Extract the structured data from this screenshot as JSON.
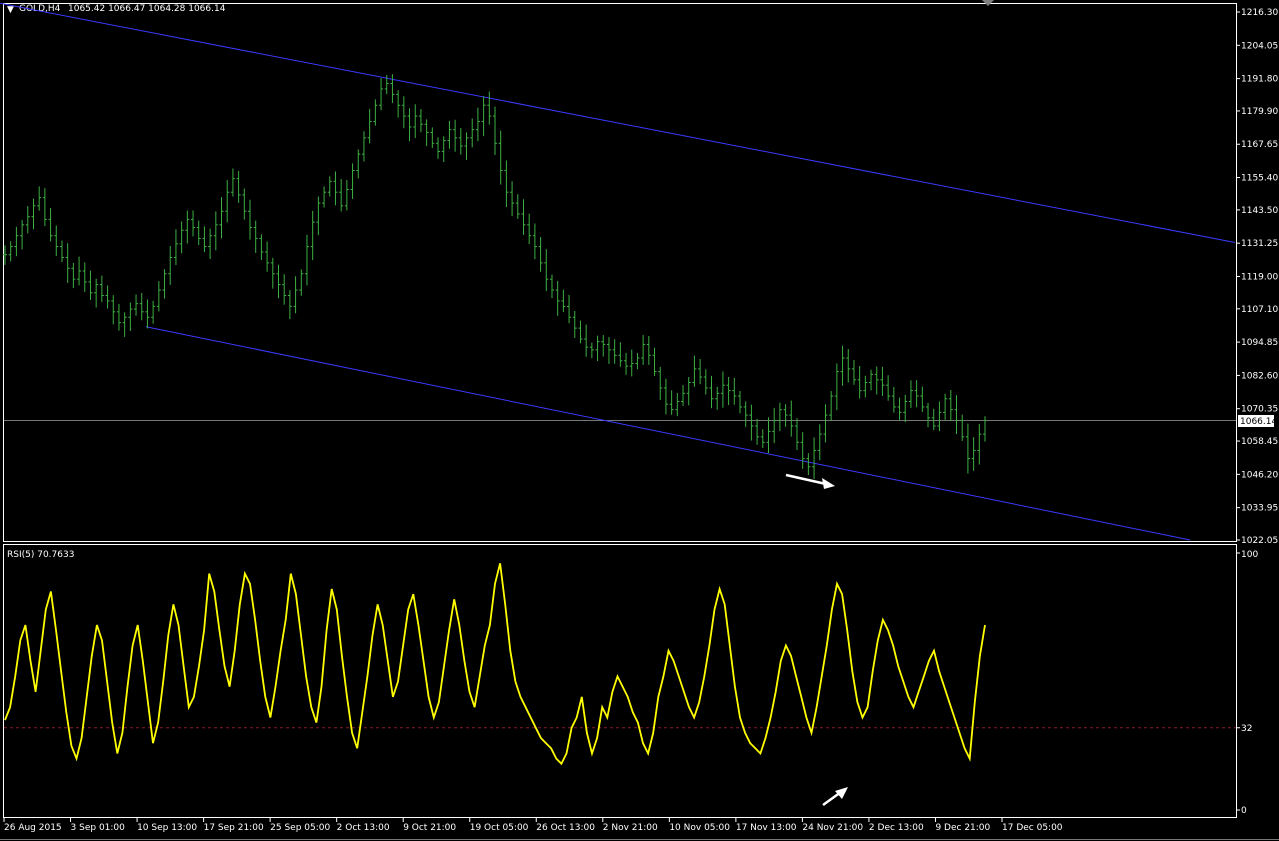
{
  "header": {
    "symbol": "GOLD,H4",
    "ohlc": "1065.42 1066.47 1064.28 1066.14",
    "rsi_label": "RSI(5) 70.7633"
  },
  "colors": {
    "background": "#000000",
    "candles": "#3cb043",
    "channel": "#3a3aff",
    "rsi_line": "#ffff00",
    "rsi_level": "#8b1a2a",
    "grid": "#ffffff",
    "arrow": "#ffffff"
  },
  "chart_data": [
    {
      "type": "bar",
      "name": "price",
      "symbol": "GOLD",
      "timeframe": "H4",
      "ylim": [
        1022.05,
        1216.3
      ],
      "y_ticks": [
        "1216.30",
        "1204.05",
        "1191.80",
        "1179.90",
        "1167.65",
        "1155.40",
        "1143.50",
        "1131.25",
        "1119.00",
        "1107.10",
        "1094.85",
        "1082.60",
        "1070.35",
        "1058.45",
        "1046.20",
        "1033.95",
        "1022.05"
      ],
      "current_price": "1066.14",
      "x_ticks": [
        "26 Aug 2015",
        "3 Sep 01:00",
        "10 Sep 13:00",
        "17 Sep 21:00",
        "25 Sep 05:00",
        "2 Oct 13:00",
        "9 Oct 21:00",
        "19 Oct 05:00",
        "26 Oct 13:00",
        "2 Nov 21:00",
        "10 Nov 05:00",
        "17 Nov 13:00",
        "24 Nov 21:00",
        "2 Dec 13:00",
        "9 Dec 21:00",
        "17 Dec 05:00"
      ],
      "closes": [
        1127,
        1130,
        1134,
        1138,
        1141,
        1145,
        1148,
        1140,
        1134,
        1130,
        1126,
        1122,
        1118,
        1121,
        1117,
        1113,
        1116,
        1112,
        1110,
        1106,
        1102,
        1104,
        1107,
        1109,
        1106,
        1104,
        1108,
        1114,
        1120,
        1126,
        1131,
        1136,
        1140,
        1137,
        1133,
        1130,
        1134,
        1138,
        1143,
        1150,
        1155,
        1149,
        1143,
        1137,
        1133,
        1128,
        1124,
        1120,
        1116,
        1112,
        1108,
        1114,
        1120,
        1130,
        1139,
        1146,
        1150,
        1154,
        1150,
        1145,
        1151,
        1158,
        1164,
        1170,
        1176,
        1182,
        1188,
        1190,
        1186,
        1182,
        1178,
        1174,
        1178,
        1175,
        1172,
        1168,
        1165,
        1169,
        1173,
        1170,
        1167,
        1170,
        1173,
        1176,
        1182,
        1178,
        1168,
        1158,
        1150,
        1146,
        1142,
        1138,
        1134,
        1130,
        1124,
        1118,
        1114,
        1110,
        1108,
        1104,
        1100,
        1096,
        1093,
        1092,
        1095,
        1094,
        1092,
        1090,
        1088,
        1086,
        1087,
        1089,
        1094,
        1090,
        1084,
        1078,
        1072,
        1070,
        1073,
        1076,
        1080,
        1085,
        1082,
        1078,
        1074,
        1076,
        1079,
        1077,
        1075,
        1071,
        1068,
        1064,
        1060,
        1058,
        1062,
        1066,
        1070,
        1068,
        1064,
        1058,
        1052,
        1049,
        1055,
        1061,
        1068,
        1075,
        1084,
        1089,
        1085,
        1081,
        1077,
        1080,
        1083,
        1081,
        1079,
        1075,
        1071,
        1069,
        1073,
        1077,
        1075,
        1071,
        1067,
        1064,
        1069,
        1074,
        1070,
        1066,
        1060,
        1052,
        1055,
        1061,
        1066
      ],
      "channel_upper": [
        [
          0,
          1219.5
        ],
        [
          1235,
          1131.5
        ]
      ],
      "channel_lower": [
        [
          146,
          1100.5
        ],
        [
          1190,
          1022.05
        ]
      ],
      "annotations": [
        "arrow-down-right near lower channel",
        "arrow-up-right near RSI low"
      ]
    },
    {
      "type": "line",
      "name": "RSI",
      "title": "RSI(5) 70.7633",
      "ylim": [
        0,
        100
      ],
      "y_ticks": [
        "100",
        "32",
        "0"
      ],
      "level": 32,
      "values": [
        35,
        40,
        52,
        66,
        72,
        58,
        46,
        62,
        78,
        85,
        70,
        54,
        38,
        25,
        20,
        28,
        44,
        60,
        72,
        66,
        50,
        34,
        22,
        30,
        48,
        64,
        72,
        58,
        42,
        26,
        34,
        50,
        68,
        80,
        72,
        56,
        40,
        44,
        56,
        70,
        92,
        85,
        70,
        56,
        48,
        62,
        80,
        92,
        88,
        74,
        58,
        44,
        36,
        48,
        62,
        74,
        92,
        84,
        68,
        52,
        40,
        34,
        48,
        70,
        86,
        78,
        60,
        44,
        30,
        24,
        38,
        52,
        68,
        80,
        72,
        58,
        44,
        50,
        64,
        78,
        84,
        72,
        58,
        44,
        36,
        42,
        56,
        70,
        82,
        72,
        58,
        46,
        40,
        52,
        64,
        72,
        88,
        96,
        80,
        62,
        50,
        44,
        40,
        36,
        32,
        28,
        26,
        24,
        20,
        18,
        22,
        32,
        36,
        44,
        30,
        22,
        28,
        40,
        36,
        46,
        52,
        48,
        44,
        38,
        34,
        26,
        22,
        30,
        44,
        52,
        62,
        58,
        52,
        46,
        40,
        36,
        42,
        52,
        64,
        78,
        86,
        80,
        64,
        48,
        36,
        30,
        26,
        24,
        22,
        28,
        36,
        46,
        58,
        64,
        60,
        52,
        44,
        36,
        30,
        40,
        52,
        64,
        78,
        88,
        84,
        70,
        54,
        42,
        36,
        40,
        54,
        66,
        74,
        70,
        64,
        56,
        50,
        44,
        40,
        46,
        52,
        58,
        62,
        54,
        48,
        42,
        36,
        30,
        24,
        20,
        42,
        60,
        72
      ]
    }
  ]
}
